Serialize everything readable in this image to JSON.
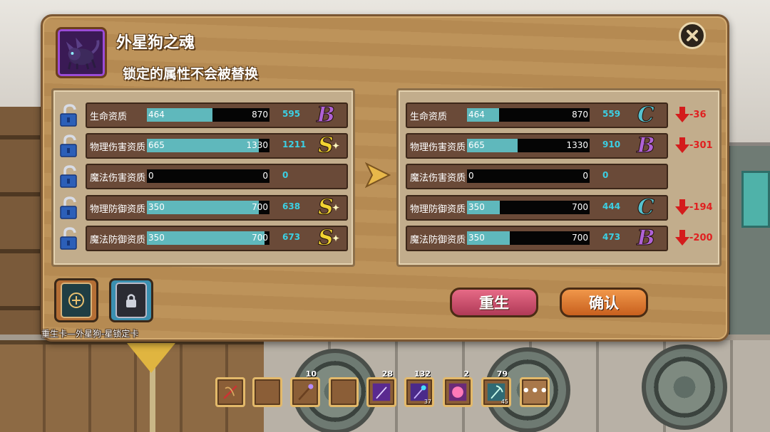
{
  "dialog": {
    "pet_name": "外星狗之魂",
    "subtitle": "锁定的属性不会被替换"
  },
  "current_attributes": [
    {
      "label": "生命资质",
      "current": "464",
      "max": "870",
      "value": "595",
      "grade": "B",
      "fill": 0.533
    },
    {
      "label": "物理伤害资质",
      "current": "665",
      "max": "1330",
      "value": "1211",
      "grade": "S",
      "fill": 0.91
    },
    {
      "label": "魔法伤害资质",
      "current": "0",
      "max": "0",
      "value": "0",
      "grade": "",
      "fill": 0
    },
    {
      "label": "物理防御资质",
      "current": "350",
      "max": "700",
      "value": "638",
      "grade": "S",
      "fill": 0.91
    },
    {
      "label": "魔法防御资质",
      "current": "350",
      "max": "700",
      "value": "673",
      "grade": "S",
      "fill": 0.96
    }
  ],
  "new_attributes": [
    {
      "label": "生命资质",
      "current": "464",
      "max": "870",
      "value": "559",
      "grade": "C",
      "fill": 0.26,
      "delta": "-36"
    },
    {
      "label": "物理伤害资质",
      "current": "665",
      "max": "1330",
      "value": "910",
      "grade": "B",
      "fill": 0.41,
      "delta": "-301"
    },
    {
      "label": "魔法伤害资质",
      "current": "0",
      "max": "0",
      "value": "0",
      "grade": "",
      "fill": 0,
      "delta": ""
    },
    {
      "label": "物理防御资质",
      "current": "350",
      "max": "700",
      "value": "444",
      "grade": "C",
      "fill": 0.27,
      "delta": "-194"
    },
    {
      "label": "魔法防御资质",
      "current": "350",
      "max": "700",
      "value": "473",
      "grade": "B",
      "fill": 0.35,
      "delta": "-200"
    }
  ],
  "items": {
    "caption": "重生卡—外星狗-星锁定卡"
  },
  "buttons": {
    "rebirth": "重生",
    "confirm": "确认"
  },
  "hotbar": {
    "slot3_count": "10",
    "slot5_count": "28",
    "slot6_count": "132",
    "slot6_sub": "37",
    "slot7_count": "2",
    "slot8_count": "79",
    "slot8_sub": "45",
    "more": "•••"
  },
  "colors": {
    "bar_fill": "#5fb8bc",
    "value_text": "#3bd0e4",
    "delta_text": "#e02020",
    "grade_B": "#b062d6",
    "grade_S": "#f2d332",
    "grade_C": "#56c2cf"
  }
}
